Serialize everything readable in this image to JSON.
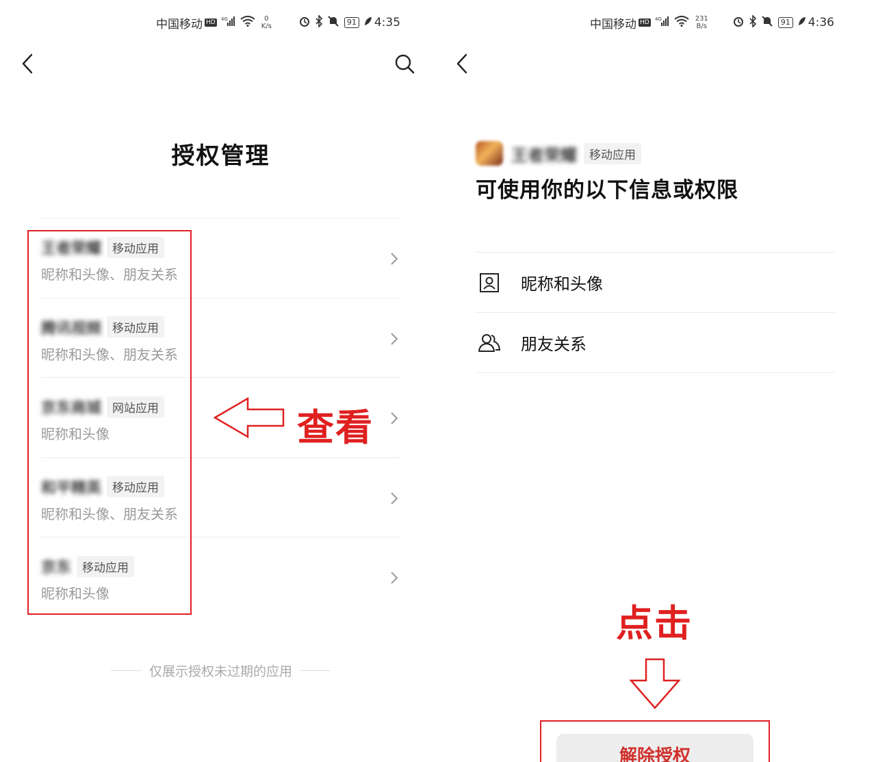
{
  "left": {
    "status": {
      "carrier": "中国移动",
      "hd": "HD",
      "signal": "4G",
      "speed_value": "0",
      "speed_unit": "K/s",
      "battery": "91",
      "time": "4:35"
    },
    "title": "授权管理",
    "apps": [
      {
        "name": "王者荣耀",
        "type": "移动应用",
        "permissions": "昵称和头像、朋友关系"
      },
      {
        "name": "腾讯视频",
        "type": "移动应用",
        "permissions": "昵称和头像、朋友关系"
      },
      {
        "name": "京东商城",
        "type": "网站应用",
        "permissions": "昵称和头像"
      },
      {
        "name": "和平精英",
        "type": "移动应用",
        "permissions": "昵称和头像、朋友关系"
      },
      {
        "name": "京东",
        "type": "移动应用",
        "permissions": "昵称和头像"
      }
    ],
    "footnote": "仅展示授权未过期的应用",
    "annotation": "查看"
  },
  "right": {
    "status": {
      "carrier": "中国移动",
      "hd": "HD",
      "signal": "4G",
      "speed_value": "231",
      "speed_unit": "B/s",
      "battery": "91",
      "time": "4:36"
    },
    "app_name": "王者荣耀",
    "app_type": "移动应用",
    "heading": "可使用你的以下信息或权限",
    "permissions": [
      {
        "label": "昵称和头像",
        "icon": "portrait-icon"
      },
      {
        "label": "朋友关系",
        "icon": "friends-icon"
      }
    ],
    "annotation": "点击",
    "revoke_label": "解除授权"
  },
  "colors": {
    "annotation_red": "#e02020",
    "revoke_text": "#d0312d"
  }
}
